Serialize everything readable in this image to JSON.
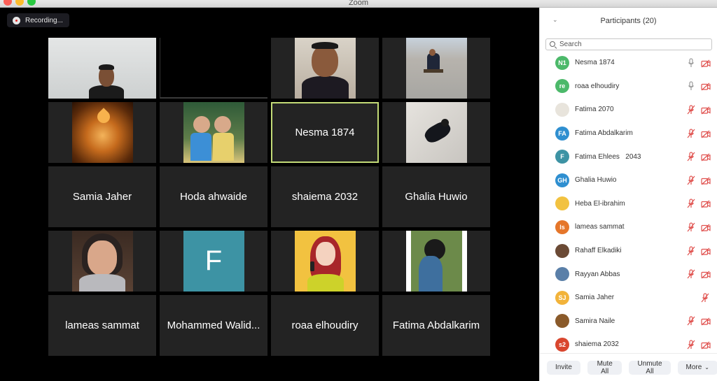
{
  "window": {
    "title": "Zoom"
  },
  "recording": {
    "label": "Recording..."
  },
  "grid": {
    "tiles": [
      {
        "type": "video",
        "label": ""
      },
      {
        "type": "black",
        "label": ""
      },
      {
        "type": "video",
        "label": ""
      },
      {
        "type": "photo",
        "label": ""
      },
      {
        "type": "photo",
        "label": ""
      },
      {
        "type": "photo",
        "label": ""
      },
      {
        "type": "name",
        "label": "Nesma 1874",
        "active": true
      },
      {
        "type": "photo",
        "label": ""
      },
      {
        "type": "name",
        "label": "Samia Jaher"
      },
      {
        "type": "name",
        "label": "Hoda ahwaide"
      },
      {
        "type": "name",
        "label": "shaiema 2032"
      },
      {
        "type": "name",
        "label": "Ghalia Huwio"
      },
      {
        "type": "photo",
        "label": ""
      },
      {
        "type": "letter",
        "label": "F"
      },
      {
        "type": "photo",
        "label": ""
      },
      {
        "type": "photo",
        "label": ""
      },
      {
        "type": "name",
        "label": "lameas sammat"
      },
      {
        "type": "name",
        "label": "Mohammed Walid..."
      },
      {
        "type": "name",
        "label": "roaa elhoudiry"
      },
      {
        "type": "name",
        "label": "Fatima Abdalkarim"
      }
    ]
  },
  "participants_panel": {
    "title": "Participants (20)",
    "search_placeholder": "Search",
    "participants": [
      {
        "name": "Nesma 1874",
        "initials": "N1",
        "color": "#4cb96a",
        "mic": "on",
        "video": "off"
      },
      {
        "name": "roaa elhoudiry",
        "initials": "re",
        "color": "#4cb96a",
        "mic": "on",
        "video": "off"
      },
      {
        "name": "Fatima 2070",
        "initials": "",
        "color": "#e8e4dc",
        "mic": "muted",
        "video": "off",
        "photo": "rocket"
      },
      {
        "name": "Fatima Abdalkarim",
        "initials": "FA",
        "color": "#2f8fd0",
        "mic": "muted",
        "video": "off"
      },
      {
        "name": "Fatima Ehlees   2043",
        "initials": "F",
        "color": "#3d93a4",
        "mic": "muted",
        "video": "off"
      },
      {
        "name": "Ghalia Huwio",
        "initials": "GH",
        "color": "#2f8fd0",
        "mic": "muted",
        "video": "off"
      },
      {
        "name": "Heba El-ibrahim",
        "initials": "",
        "color": "#f2c240",
        "mic": "muted",
        "video": "off",
        "photo": "avatar-red-hair"
      },
      {
        "name": "lameas sammat",
        "initials": "ls",
        "color": "#e5762a",
        "mic": "muted",
        "video": "off"
      },
      {
        "name": "Rahaff Elkadiki",
        "initials": "",
        "color": "#6b4a35",
        "mic": "muted",
        "video": "off",
        "photo": "portrait"
      },
      {
        "name": "Rayyan Abbas",
        "initials": "",
        "color": "#5a7fa8",
        "mic": "muted",
        "video": "off",
        "photo": "kids"
      },
      {
        "name": "Samia Jaher",
        "initials": "SJ",
        "color": "#f2b33a",
        "mic": "muted",
        "video": "none"
      },
      {
        "name": "Samira Naile",
        "initials": "",
        "color": "#8a5a2a",
        "mic": "muted",
        "video": "off",
        "photo": "leaf"
      },
      {
        "name": "shaiema 2032",
        "initials": "s2",
        "color": "#d9462e",
        "mic": "muted",
        "video": "off"
      }
    ],
    "footer": {
      "invite": "Invite",
      "mute_all": "Mute All",
      "unmute_all": "Unmute All",
      "more": "More"
    }
  },
  "colors": {
    "active_speaker": "#c3db77",
    "muted_icon": "#e0524f"
  }
}
